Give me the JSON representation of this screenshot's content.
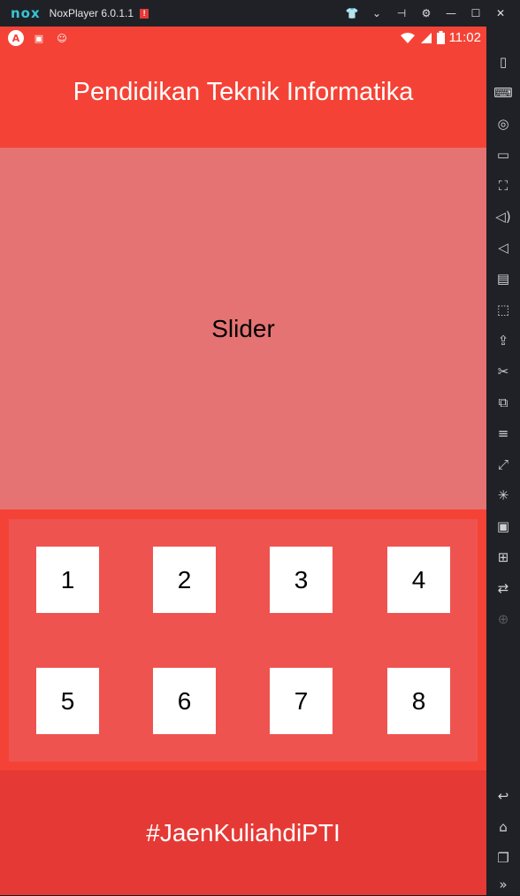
{
  "window": {
    "logo_text": "nox",
    "app_name": "NoxPlayer 6.0.1.1",
    "alert_badge": "!",
    "controls": [
      {
        "name": "shirt-icon",
        "glyph": "👕"
      },
      {
        "name": "chevron-down-icon",
        "glyph": "⌄"
      },
      {
        "name": "pin-icon",
        "glyph": "⊣"
      },
      {
        "name": "gear-icon",
        "glyph": "⚙"
      },
      {
        "name": "minimize-icon",
        "glyph": "—"
      },
      {
        "name": "maximize-icon",
        "glyph": "☐"
      },
      {
        "name": "close-icon",
        "glyph": "✕"
      }
    ]
  },
  "statusbar": {
    "left_icons": [
      "A",
      "▣",
      "☺"
    ],
    "right_icons": [
      "wifi-icon",
      "signal-icon",
      "battery-icon"
    ],
    "time": "11:02"
  },
  "app": {
    "title": "Pendidikan Teknik Informatika",
    "slider_label": "Slider",
    "tiles": [
      "1",
      "2",
      "3",
      "4",
      "5",
      "6",
      "7",
      "8"
    ],
    "footer_text": "#JaenKuliahdiPTI",
    "colors": {
      "appbar": "#f44336",
      "slider": "#e57373",
      "grid": "#ef5350",
      "footer": "#e53935",
      "tile": "#ffffff"
    }
  },
  "sidebar": {
    "tools": [
      {
        "name": "shake-icon",
        "glyph": "▯"
      },
      {
        "name": "keyboard-icon",
        "glyph": "⌨"
      },
      {
        "name": "location-icon",
        "glyph": "◎"
      },
      {
        "name": "screen-icon",
        "glyph": "▭"
      },
      {
        "name": "fullscreen-icon",
        "glyph": "⛶"
      },
      {
        "name": "volume-up-icon",
        "glyph": "◁)"
      },
      {
        "name": "volume-down-icon",
        "glyph": "◁"
      },
      {
        "name": "toolbox-icon",
        "glyph": "▤"
      },
      {
        "name": "screenshot-icon",
        "glyph": "⬚"
      },
      {
        "name": "apk-icon",
        "glyph": "⇪"
      },
      {
        "name": "scissors-icon",
        "glyph": "✂"
      },
      {
        "name": "multi-instance-icon",
        "glyph": "⧉"
      },
      {
        "name": "menu-icon",
        "glyph": "≡"
      },
      {
        "name": "shortcut-icon",
        "glyph": "⤢"
      },
      {
        "name": "loading-icon",
        "glyph": "✳"
      },
      {
        "name": "record-icon",
        "glyph": "▣"
      },
      {
        "name": "gamepad-icon",
        "glyph": "⊞"
      },
      {
        "name": "sync-icon",
        "glyph": "⇄"
      },
      {
        "name": "add-icon",
        "glyph": "⊕"
      },
      {
        "name": "back-icon",
        "glyph": "↩"
      },
      {
        "name": "home-icon",
        "glyph": "⌂"
      },
      {
        "name": "recents-icon",
        "glyph": "❐"
      },
      {
        "name": "more-icon",
        "glyph": "»"
      }
    ]
  }
}
